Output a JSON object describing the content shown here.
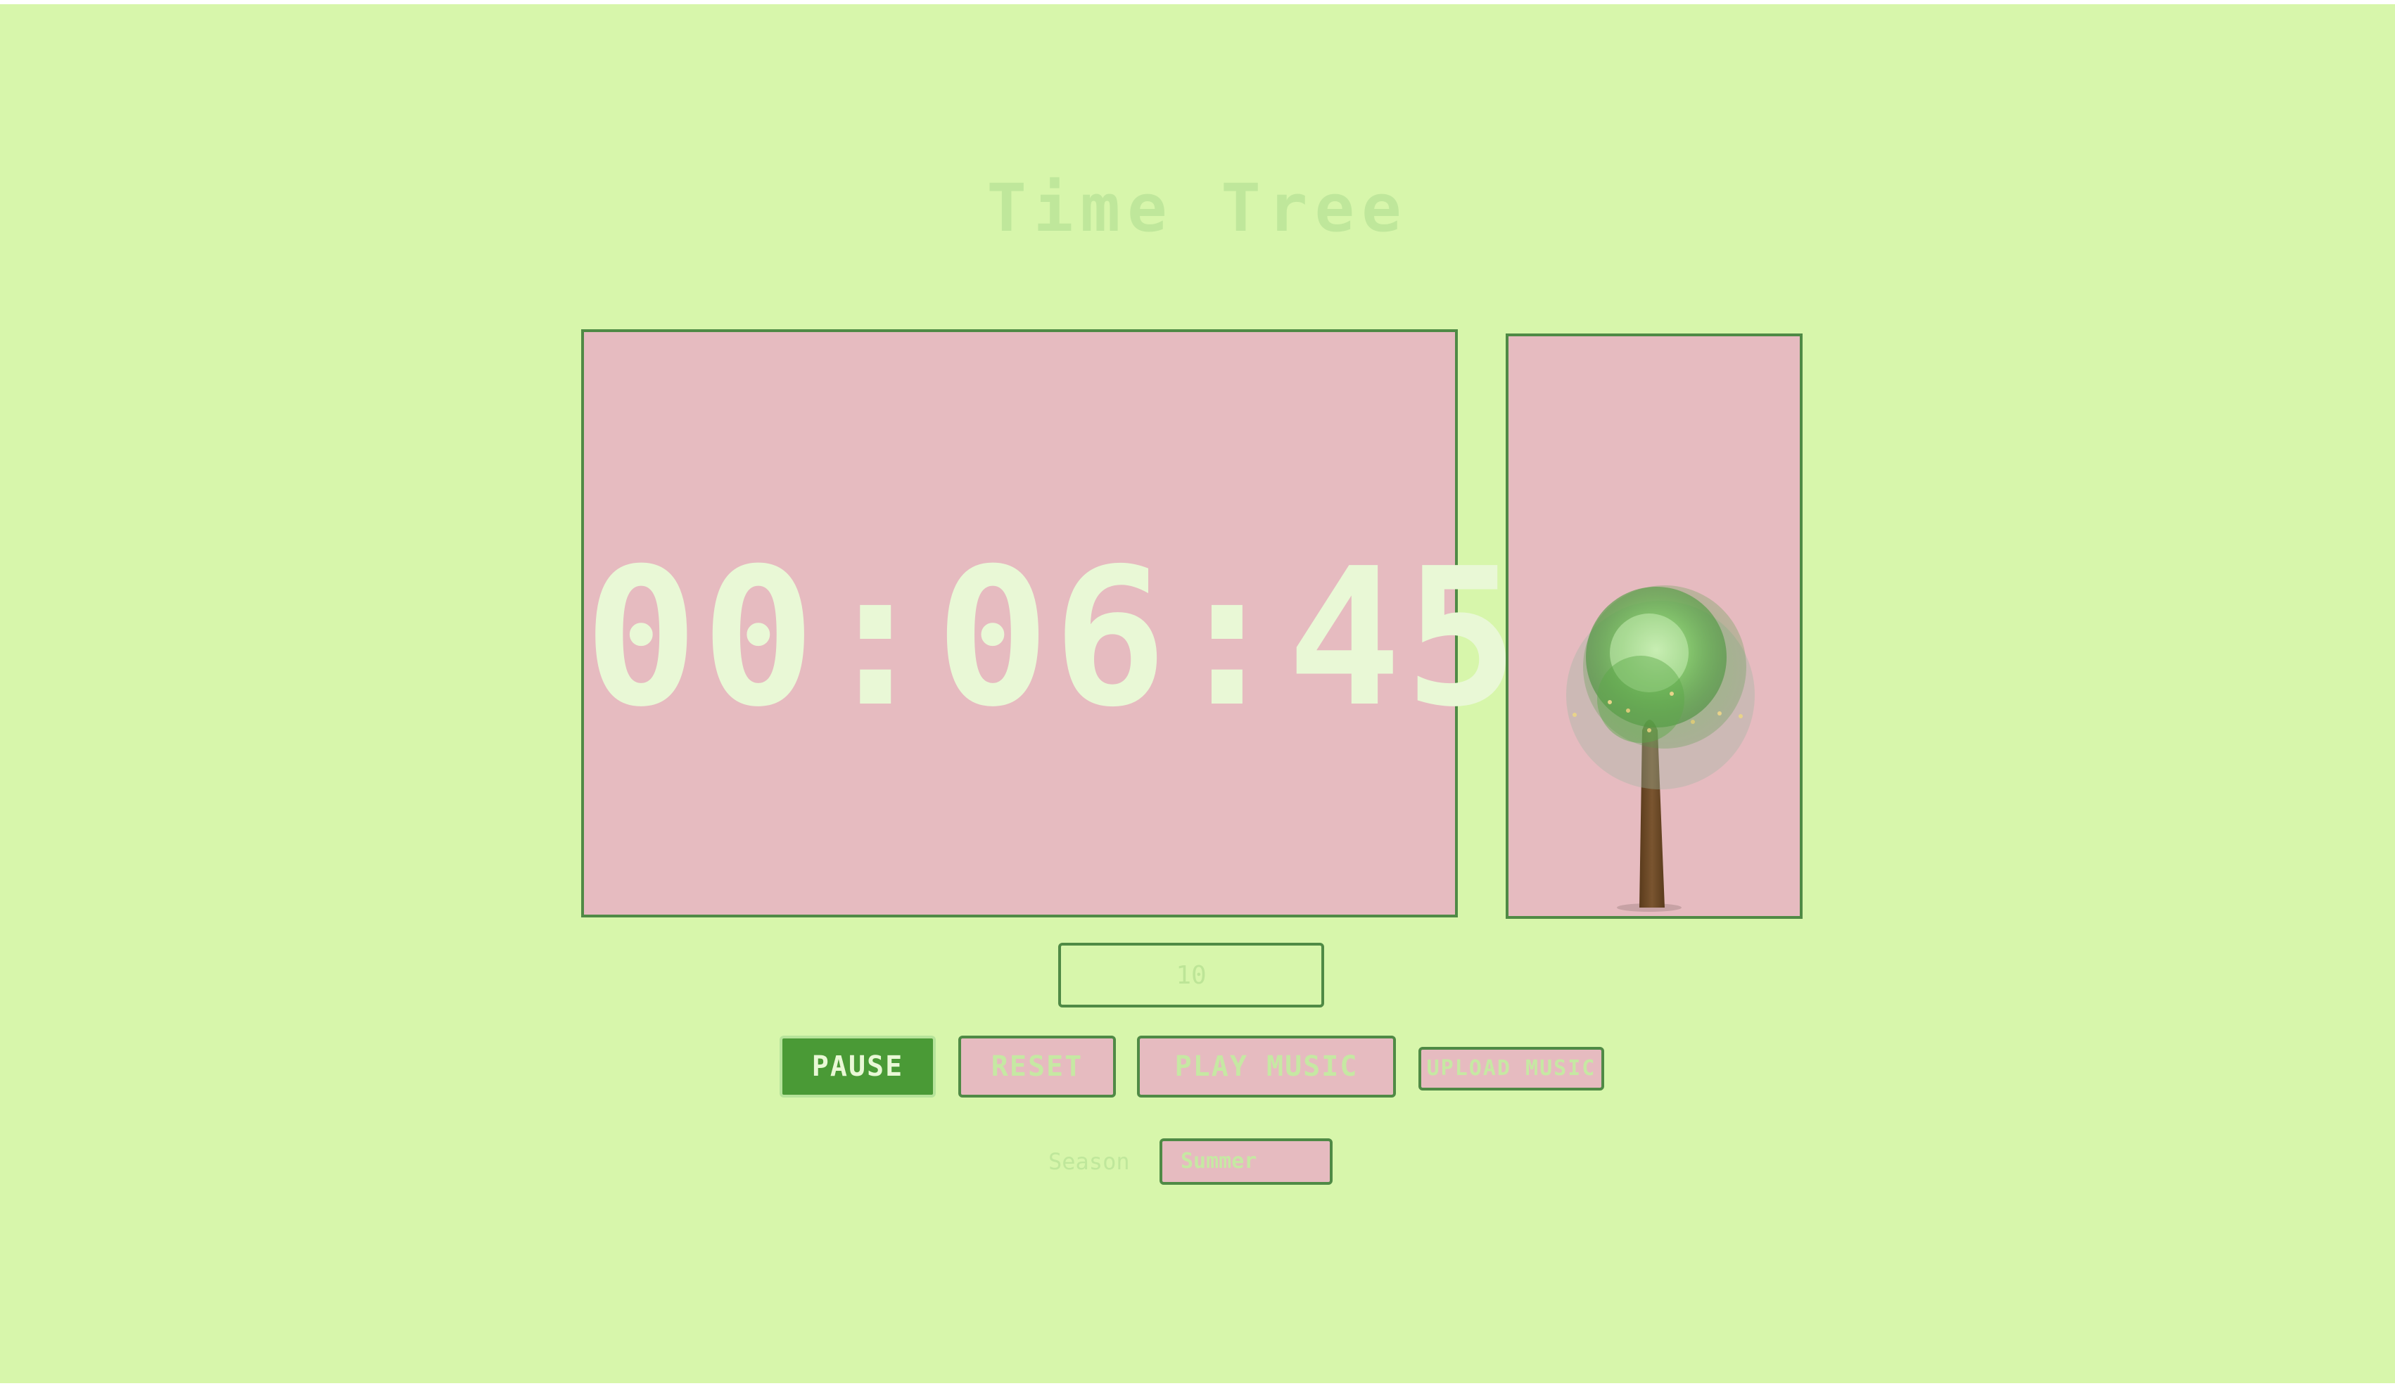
{
  "app": {
    "title": "Time Tree"
  },
  "timer": {
    "display": "00:06:45"
  },
  "minutes_input": {
    "value": "10"
  },
  "controls": {
    "pause_label": "PAUSE",
    "reset_label": "RESET",
    "play_music_label": "PLAY MUSIC",
    "upload_music_label": "UPLOAD MUSIC"
  },
  "season": {
    "label": "Season",
    "selected": "Summer"
  },
  "colors": {
    "background": "#d7f6ab",
    "panel": "#e6bbc0",
    "border": "#4f8a45",
    "primary_button": "#4a9a36",
    "digits": "#e9f8d6",
    "tree_trunk": "#6b4a25",
    "tree_foliage": "#4f9c3a"
  }
}
